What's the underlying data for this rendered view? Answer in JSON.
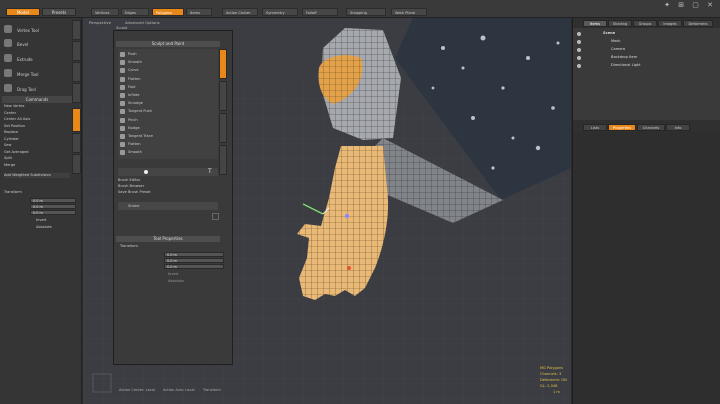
{
  "topbar": {
    "modes": [
      "Model",
      "Presets"
    ],
    "tools": [
      "Vertices",
      "Edges",
      "Polygons",
      "Items"
    ],
    "menus": [
      "Action Center",
      "Symmetry",
      "Falloff",
      "Snapping",
      "Work Plane"
    ]
  },
  "leftpanel": {
    "tools": [
      "Vertex Tool",
      "Bevel",
      "Extrude",
      "Merge Tool",
      "Drag Tool"
    ],
    "commands_header": "Commands",
    "commands": [
      "New Vertex",
      "Center",
      "Center All Axis",
      "Set Position",
      "Replace",
      "Cylinder",
      "Sew",
      "Get Averaged",
      "Split",
      "Merge"
    ],
    "footer": "Add Weighted Subdivision",
    "transform_header": "Transform",
    "fields": [
      "0.0 m",
      "0.0 m",
      "0.0 m"
    ],
    "checks": [
      "Invert",
      "Absolute"
    ]
  },
  "viewport": {
    "tabs": [
      "Perspective",
      "Advanced Options"
    ],
    "status_lines": [
      "MG Polygons",
      "Channels: 3",
      "Deformers: ON",
      "GL: 2,046",
      "1 m"
    ],
    "bottom_info": [
      "Action Center: Local",
      "Action Axis: Local",
      "Transform"
    ]
  },
  "toolpanel": {
    "title": "Sculpt and Paint",
    "tab": "Sculpt",
    "items": [
      "Push",
      "Smooth",
      "Carve",
      "Flatten",
      "Fold",
      "Inflate",
      "Smudge",
      "Tangent Push",
      "Pinch",
      "Nudge",
      "Tangent Trace",
      "Flatten",
      "Smooth"
    ],
    "brush_header": "Brush Editor",
    "brush_items": [
      "Brush Browser",
      "Save Brush Preset"
    ],
    "stroke_label": "Stroke",
    "tool_props": "Tool Properties",
    "transform": "Transform",
    "fields": [
      "0.0 m",
      "0.0 m",
      "0.0 m"
    ],
    "checks": [
      "Invert",
      "Absolute"
    ]
  },
  "rightpanel": {
    "tabs": [
      "Items",
      "Shading",
      "Groups",
      "Images",
      "Deformers"
    ],
    "tree": [
      "Scene",
      "Mesh",
      "Camera",
      "Backdrop Item",
      "Directional Light"
    ],
    "bottom_tabs": [
      "Lists",
      "Properties",
      "Channels",
      "Info"
    ]
  }
}
